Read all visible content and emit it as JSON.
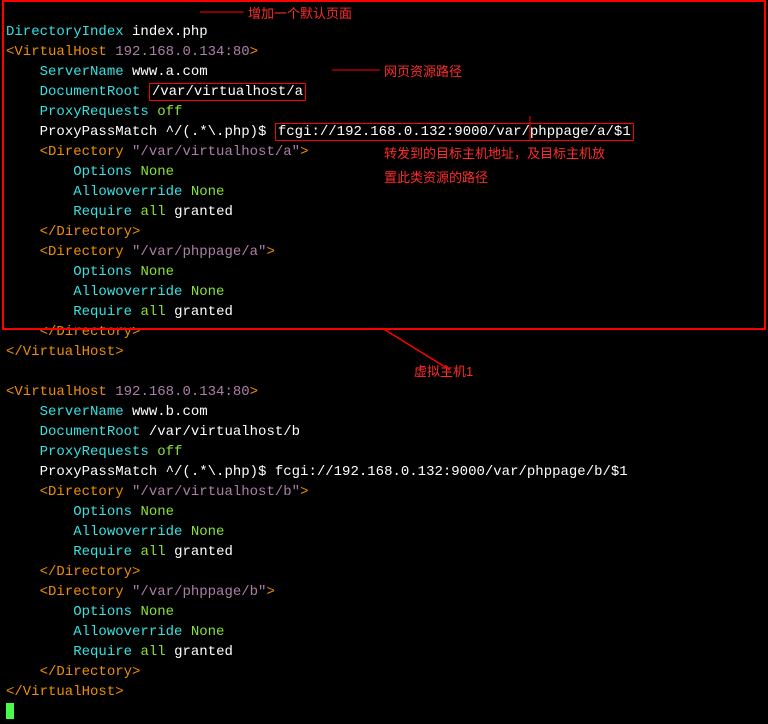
{
  "l1": {
    "a": "DirectoryIndex",
    "b": "index.php"
  },
  "l2": {
    "a": "<VirtualHost",
    "b": "192.168.0.134:80",
    "c": ">"
  },
  "l3": {
    "a": "ServerName",
    "b": "www.a.com"
  },
  "l4": {
    "a": "DocumentRoot",
    "b": "/var/virtualhost/a"
  },
  "l5": {
    "a": "ProxyRequests",
    "b": "off"
  },
  "l6": {
    "a": "ProxyPassMatch ^/(.*\\.php)$",
    "b": "fcgi://192.168.0.132:9000/var/phppage/a/$1"
  },
  "l7": {
    "a": "<Directory",
    "b": "\"/var/virtualhost/a\"",
    "c": ">"
  },
  "l8": {
    "a": "Options",
    "b": "None"
  },
  "l9": {
    "a": "Allowoverride",
    "b": "None"
  },
  "l10": {
    "a": "Require",
    "b": "all",
    "c": "granted"
  },
  "l11": "</Directory>",
  "l12": {
    "a": "<Directory",
    "b": "\"/var/phppage/a\"",
    "c": ">"
  },
  "l13": {
    "a": "Options",
    "b": "None"
  },
  "l14": {
    "a": "Allowoverride",
    "b": "None"
  },
  "l15": {
    "a": "Require",
    "b": "all",
    "c": "granted"
  },
  "l16": "</Directory>",
  "l17": "</VirtualHost>",
  "b2": {
    "a": "<VirtualHost",
    "b": "192.168.0.134:80",
    "c": ">"
  },
  "b3": {
    "a": "ServerName",
    "b": "www.b.com"
  },
  "b4": {
    "a": "DocumentRoot",
    "b": "/var/virtualhost/b"
  },
  "b5": {
    "a": "ProxyRequests",
    "b": "off"
  },
  "b6": {
    "a": "ProxyPassMatch ^/(.*\\.php)$ fcgi://192.168.0.132:9000/var/phppage/b/$1"
  },
  "b7": {
    "a": "<Directory",
    "b": "\"/var/virtualhost/b\"",
    "c": ">"
  },
  "b8": {
    "a": "Options",
    "b": "None"
  },
  "b9": {
    "a": "Allowoverride",
    "b": "None"
  },
  "b10": {
    "a": "Require",
    "b": "all",
    "c": "granted"
  },
  "b11": "</Directory>",
  "b12": {
    "a": "<Directory",
    "b": "\"/var/phppage/b\"",
    "c": ">"
  },
  "b13": {
    "a": "Options",
    "b": "None"
  },
  "b14": {
    "a": "Allowoverride",
    "b": "None"
  },
  "b15": {
    "a": "Require",
    "b": "all",
    "c": "granted"
  },
  "b16": "</Directory>",
  "b17": "</VirtualHost>",
  "annot": {
    "default_page": "增加一个默认页面",
    "docroot": "网页资源路径",
    "fcgi1": "转发到的目标主机地址，及目标主机放",
    "fcgi2": "置此类资源的路径",
    "vhost": "虚拟主机1"
  }
}
